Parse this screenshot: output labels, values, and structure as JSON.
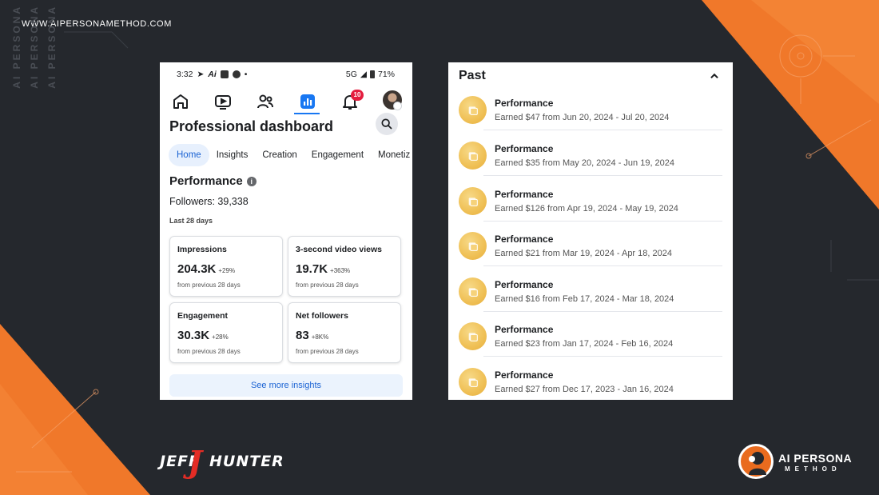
{
  "site": {
    "url": "WWW.AIPERSONAMETHOD.COM",
    "vertical_brand": "AI PERSONA"
  },
  "status_bar": {
    "time": "3:32",
    "network": "5G",
    "battery": "71%"
  },
  "nav": {
    "notification_count": "10"
  },
  "dashboard": {
    "title": "Professional dashboard",
    "tabs": [
      "Home",
      "Insights",
      "Creation",
      "Engagement",
      "Monetiz"
    ],
    "performance_heading": "Performance",
    "info_glyph": "i",
    "followers": "Followers: 39,338",
    "period": "Last 28 days",
    "cards": [
      {
        "label": "Impressions",
        "value": "204.3K",
        "delta": "+29%",
        "note": "from previous 28 days"
      },
      {
        "label": "3-second video views",
        "value": "19.7K",
        "delta": "+363%",
        "note": "from previous 28 days"
      },
      {
        "label": "Engagement",
        "value": "30.3K",
        "delta": "+28%",
        "note": "from previous 28 days"
      },
      {
        "label": "Net followers",
        "value": "83",
        "delta": "+8K%",
        "note": "from previous 28 days"
      }
    ],
    "see_more": "See more insights"
  },
  "past": {
    "title": "Past",
    "items": [
      {
        "title": "Performance",
        "desc": "Earned $47 from Jun 20, 2024 - Jul 20, 2024"
      },
      {
        "title": "Performance",
        "desc": "Earned $35 from May 20, 2024 - Jun 19, 2024"
      },
      {
        "title": "Performance",
        "desc": "Earned $126 from Apr 19, 2024 - May 19, 2024"
      },
      {
        "title": "Performance",
        "desc": "Earned $21 from Mar 19, 2024 - Apr 18, 2024"
      },
      {
        "title": "Performance",
        "desc": "Earned $16 from Feb 17, 2024 - Mar 18, 2024"
      },
      {
        "title": "Performance",
        "desc": "Earned $23 from Jan 17, 2024 - Feb 16, 2024"
      },
      {
        "title": "Performance",
        "desc": "Earned $27 from Dec 17, 2023 - Jan 16, 2024"
      }
    ]
  },
  "logos": {
    "jeff_left": "JEFF",
    "jeff_j": "J",
    "jeff_right": "HUNTER",
    "ai_persona_name": "AI PERSONA",
    "ai_persona_sub": "METHOD"
  },
  "colors": {
    "accent": "#1877f2",
    "orange": "#f0782a",
    "dark_bg": "#25282d",
    "coin": "#f0c259"
  },
  "icons": [
    "home-icon",
    "video-icon",
    "friends-icon",
    "dashboard-icon",
    "bell-icon",
    "search-icon",
    "info-icon",
    "chevron-up-icon",
    "coin-stack-icon"
  ]
}
